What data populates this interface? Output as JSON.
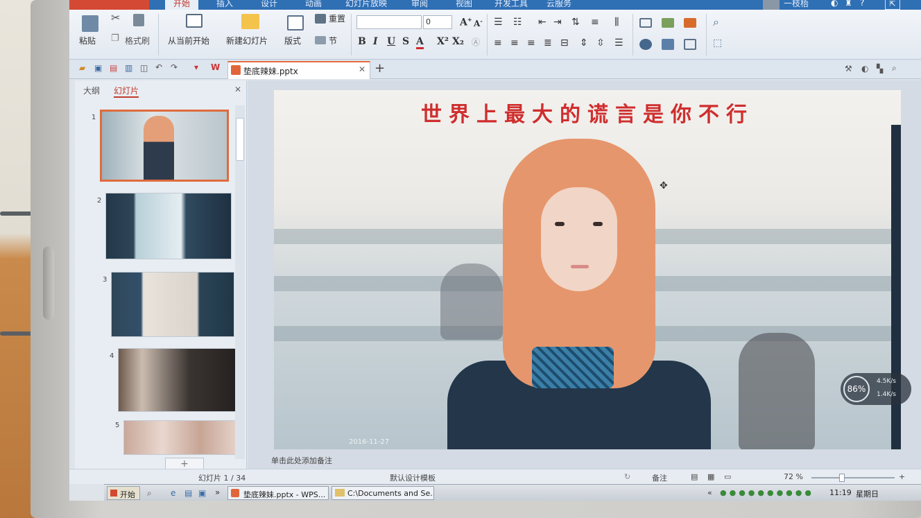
{
  "ribbon_tabs": [
    "开始",
    "插入",
    "设计",
    "动画",
    "幻灯片放映",
    "审阅",
    "视图",
    "开发工具",
    "云服务"
  ],
  "user": {
    "name": "一枝梧"
  },
  "clipboard": {
    "paste": "粘贴",
    "format_painter": "格式刷"
  },
  "slides_group": {
    "from_current": "从当前开始",
    "new_slide": "新建幻灯片",
    "layout": "版式",
    "section": "节",
    "reset": "重置"
  },
  "font": {
    "name_value": "",
    "size_value": "0"
  },
  "format_buttons": [
    "B",
    "I",
    "U",
    "S",
    "A",
    "X²",
    "X₂"
  ],
  "document_tab": {
    "name": "垫底辣妹.pptx"
  },
  "left_panel": {
    "tabs": [
      "大纲",
      "幻灯片"
    ],
    "active_tab": "幻灯片",
    "slide_numbers": [
      "1",
      "2",
      "3",
      "4",
      "5"
    ],
    "add_button": "+"
  },
  "slide": {
    "title": "世界上最大的谎言是你不行",
    "date": "2016-11-27"
  },
  "notes_placeholder": "单击此处添加备注",
  "status_bar": {
    "slide_counter": "幻灯片 1 / 34",
    "template": "默认设计模板",
    "notes_label": "备注",
    "zoom": "72 %"
  },
  "speed_widget": {
    "percent": "86%",
    "up": "4.5K/s",
    "down": "1.4K/s"
  },
  "taskbar": {
    "start": "开始",
    "items": [
      "垫底辣妹.pptx - WPS...",
      "C:\\Documents and Se..."
    ],
    "clock_time": "11:19",
    "clock_day": "星期日"
  },
  "colors": {
    "accent": "#c0392b",
    "title_red": "#cf2e2e",
    "ribbon_blue": "#2f6fb4",
    "selection_orange": "#e06b3c"
  }
}
